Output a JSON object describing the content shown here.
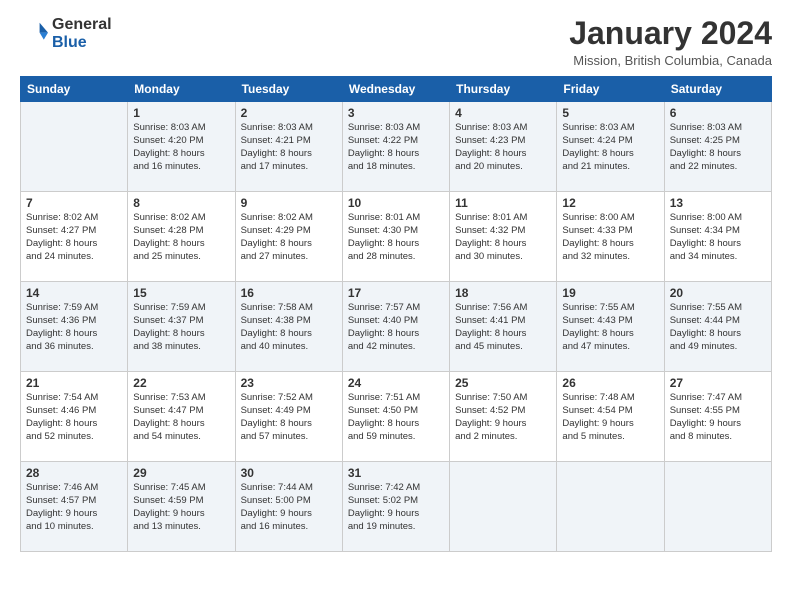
{
  "header": {
    "logo_line1": "General",
    "logo_line2": "Blue",
    "month": "January 2024",
    "location": "Mission, British Columbia, Canada"
  },
  "weekdays": [
    "Sunday",
    "Monday",
    "Tuesday",
    "Wednesday",
    "Thursday",
    "Friday",
    "Saturday"
  ],
  "weeks": [
    [
      {
        "day": "",
        "info": ""
      },
      {
        "day": "1",
        "info": "Sunrise: 8:03 AM\nSunset: 4:20 PM\nDaylight: 8 hours\nand 16 minutes."
      },
      {
        "day": "2",
        "info": "Sunrise: 8:03 AM\nSunset: 4:21 PM\nDaylight: 8 hours\nand 17 minutes."
      },
      {
        "day": "3",
        "info": "Sunrise: 8:03 AM\nSunset: 4:22 PM\nDaylight: 8 hours\nand 18 minutes."
      },
      {
        "day": "4",
        "info": "Sunrise: 8:03 AM\nSunset: 4:23 PM\nDaylight: 8 hours\nand 20 minutes."
      },
      {
        "day": "5",
        "info": "Sunrise: 8:03 AM\nSunset: 4:24 PM\nDaylight: 8 hours\nand 21 minutes."
      },
      {
        "day": "6",
        "info": "Sunrise: 8:03 AM\nSunset: 4:25 PM\nDaylight: 8 hours\nand 22 minutes."
      }
    ],
    [
      {
        "day": "7",
        "info": "Sunrise: 8:02 AM\nSunset: 4:27 PM\nDaylight: 8 hours\nand 24 minutes."
      },
      {
        "day": "8",
        "info": "Sunrise: 8:02 AM\nSunset: 4:28 PM\nDaylight: 8 hours\nand 25 minutes."
      },
      {
        "day": "9",
        "info": "Sunrise: 8:02 AM\nSunset: 4:29 PM\nDaylight: 8 hours\nand 27 minutes."
      },
      {
        "day": "10",
        "info": "Sunrise: 8:01 AM\nSunset: 4:30 PM\nDaylight: 8 hours\nand 28 minutes."
      },
      {
        "day": "11",
        "info": "Sunrise: 8:01 AM\nSunset: 4:32 PM\nDaylight: 8 hours\nand 30 minutes."
      },
      {
        "day": "12",
        "info": "Sunrise: 8:00 AM\nSunset: 4:33 PM\nDaylight: 8 hours\nand 32 minutes."
      },
      {
        "day": "13",
        "info": "Sunrise: 8:00 AM\nSunset: 4:34 PM\nDaylight: 8 hours\nand 34 minutes."
      }
    ],
    [
      {
        "day": "14",
        "info": "Sunrise: 7:59 AM\nSunset: 4:36 PM\nDaylight: 8 hours\nand 36 minutes."
      },
      {
        "day": "15",
        "info": "Sunrise: 7:59 AM\nSunset: 4:37 PM\nDaylight: 8 hours\nand 38 minutes."
      },
      {
        "day": "16",
        "info": "Sunrise: 7:58 AM\nSunset: 4:38 PM\nDaylight: 8 hours\nand 40 minutes."
      },
      {
        "day": "17",
        "info": "Sunrise: 7:57 AM\nSunset: 4:40 PM\nDaylight: 8 hours\nand 42 minutes."
      },
      {
        "day": "18",
        "info": "Sunrise: 7:56 AM\nSunset: 4:41 PM\nDaylight: 8 hours\nand 45 minutes."
      },
      {
        "day": "19",
        "info": "Sunrise: 7:55 AM\nSunset: 4:43 PM\nDaylight: 8 hours\nand 47 minutes."
      },
      {
        "day": "20",
        "info": "Sunrise: 7:55 AM\nSunset: 4:44 PM\nDaylight: 8 hours\nand 49 minutes."
      }
    ],
    [
      {
        "day": "21",
        "info": "Sunrise: 7:54 AM\nSunset: 4:46 PM\nDaylight: 8 hours\nand 52 minutes."
      },
      {
        "day": "22",
        "info": "Sunrise: 7:53 AM\nSunset: 4:47 PM\nDaylight: 8 hours\nand 54 minutes."
      },
      {
        "day": "23",
        "info": "Sunrise: 7:52 AM\nSunset: 4:49 PM\nDaylight: 8 hours\nand 57 minutes."
      },
      {
        "day": "24",
        "info": "Sunrise: 7:51 AM\nSunset: 4:50 PM\nDaylight: 8 hours\nand 59 minutes."
      },
      {
        "day": "25",
        "info": "Sunrise: 7:50 AM\nSunset: 4:52 PM\nDaylight: 9 hours\nand 2 minutes."
      },
      {
        "day": "26",
        "info": "Sunrise: 7:48 AM\nSunset: 4:54 PM\nDaylight: 9 hours\nand 5 minutes."
      },
      {
        "day": "27",
        "info": "Sunrise: 7:47 AM\nSunset: 4:55 PM\nDaylight: 9 hours\nand 8 minutes."
      }
    ],
    [
      {
        "day": "28",
        "info": "Sunrise: 7:46 AM\nSunset: 4:57 PM\nDaylight: 9 hours\nand 10 minutes."
      },
      {
        "day": "29",
        "info": "Sunrise: 7:45 AM\nSunset: 4:59 PM\nDaylight: 9 hours\nand 13 minutes."
      },
      {
        "day": "30",
        "info": "Sunrise: 7:44 AM\nSunset: 5:00 PM\nDaylight: 9 hours\nand 16 minutes."
      },
      {
        "day": "31",
        "info": "Sunrise: 7:42 AM\nSunset: 5:02 PM\nDaylight: 9 hours\nand 19 minutes."
      },
      {
        "day": "",
        "info": ""
      },
      {
        "day": "",
        "info": ""
      },
      {
        "day": "",
        "info": ""
      }
    ]
  ]
}
